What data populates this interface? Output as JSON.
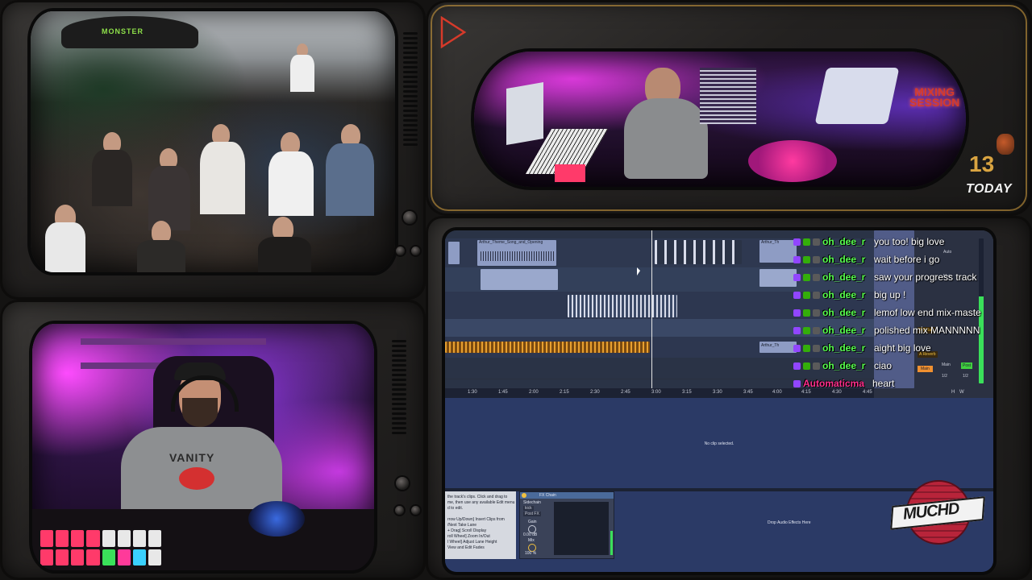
{
  "overlay": {
    "mixing_session_label": "MIXING\nSESSION",
    "date_number": "13",
    "date_label": "TODAY",
    "logo_text": "MUCHD"
  },
  "crowd_feed": {
    "banner_text": "MONSTER"
  },
  "webcam": {
    "hoodie_text": "VANITY"
  },
  "daw": {
    "clip_names": [
      "Arthur_Theme_Song_and_Opening",
      "Arthur_Th",
      "Arthur_Th"
    ],
    "ruler_ticks": [
      "1:30",
      "1:45",
      "2:00",
      "2:15",
      "2:30",
      "2:45",
      "3:00",
      "3:15",
      "3:30",
      "3:45",
      "4:00",
      "4:15",
      "4:30",
      "4:45"
    ],
    "detail_empty_text": "No clip selected.",
    "drop_effects_text": "Drop Audio Effects Here",
    "device_name": "FX Chain",
    "device_labels": {
      "sidechain": "Sidechain",
      "kick": "kick",
      "post_fx": "Post FX",
      "gain": "Gain",
      "gain_value": "0.00 dB",
      "mix": "Mix",
      "mix_value": "100 %"
    },
    "help_lines": [
      "the track's clips. Click and drag to",
      "me, then use any available Edit menu",
      "d to edit.",
      "",
      "rrow Up/Down] Insert Clips from",
      "/Next Take Lane",
      "+ Drag] Scroll Display",
      "roll Wheel] Zoom In/Out",
      "l Wheel] Adjust Lane Height",
      "View and Edit Fades"
    ],
    "mixer_labels": [
      "Main",
      "Main",
      "1/2",
      "1/2",
      "A Reverb",
      "B Delay",
      "Post",
      "Auto",
      "Main"
    ],
    "transport_labels": [
      "H",
      "W"
    ]
  },
  "chat": {
    "messages": [
      {
        "user": "oh_dee_r",
        "text": "you too! big love"
      },
      {
        "user": "oh_dee_r",
        "text": "wait before i go"
      },
      {
        "user": "oh_dee_r",
        "text": "saw your progress track"
      },
      {
        "user": "oh_dee_r",
        "text": "big up !"
      },
      {
        "user": "oh_dee_r",
        "text": "lemof low end mix-maste"
      },
      {
        "user": "oh_dee_r",
        "text": "polished mix MANNNNN"
      },
      {
        "user": "oh_dee_r",
        "text": "aight big love"
      },
      {
        "user": "oh_dee_r",
        "text": "ciao"
      },
      {
        "user": "Automaticma",
        "text": "heart"
      }
    ],
    "user_color_default": "#58ff50",
    "user_color_alt": "#ff2f8d"
  },
  "colors": {
    "accent_red": "#d63a2a",
    "date_gold": "#d9a441",
    "daw_bg": "#1f2330",
    "chat_green": "#58ff50"
  }
}
